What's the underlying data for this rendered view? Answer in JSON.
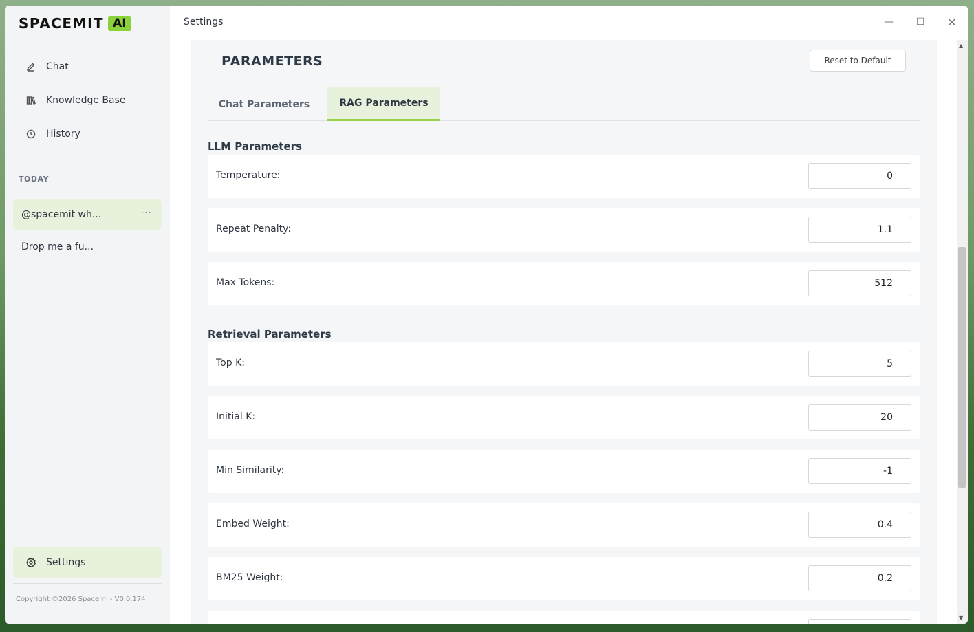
{
  "brand": {
    "name": "SPACEMIT",
    "badge": "AI"
  },
  "sidebar": {
    "nav": [
      {
        "label": "Chat",
        "icon": "pencil-icon"
      },
      {
        "label": "Knowledge Base",
        "icon": "books-icon"
      },
      {
        "label": "History",
        "icon": "clock-icon"
      }
    ],
    "section_label": "TODAY",
    "history": [
      {
        "label": "@spacemit wh..."
      },
      {
        "label": "Drop me a fu..."
      }
    ],
    "more_label": "···",
    "settings_label": "Settings",
    "copyright": "Copyright ©2026 Spacemi - V0.0.174"
  },
  "window": {
    "title": "Settings",
    "minimize": "—",
    "maximize": "☐",
    "close": "✕"
  },
  "main": {
    "title": "PARAMETERS",
    "reset_label": "Reset to Default",
    "tabs": [
      {
        "label": "Chat Parameters",
        "active": false
      },
      {
        "label": "RAG Parameters",
        "active": true
      }
    ],
    "llm_title": "LLM Parameters",
    "llm": [
      {
        "label": "Temperature:",
        "value": "0"
      },
      {
        "label": "Repeat Penalty:",
        "value": "1.1"
      },
      {
        "label": "Max Tokens:",
        "value": "512"
      }
    ],
    "retrieval_title": "Retrieval Parameters",
    "retrieval": [
      {
        "label": "Top K:",
        "value": "5"
      },
      {
        "label": "Initial K:",
        "value": "20"
      },
      {
        "label": "Min Similarity:",
        "value": "-1"
      },
      {
        "label": "Embed Weight:",
        "value": "0.4"
      },
      {
        "label": "BM25 Weight:",
        "value": "0.2"
      }
    ]
  },
  "colors": {
    "accent": "#8ad13a",
    "active_bg": "#e8f1dc",
    "tab_underline": "#9ad04a"
  }
}
